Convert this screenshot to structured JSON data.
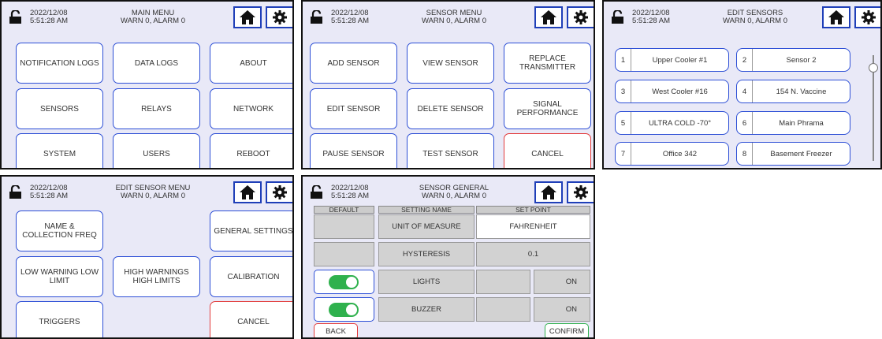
{
  "status": {
    "date": "2022/12/08",
    "time": "5:51:28 AM",
    "warn_alarm": "WARN 0, ALARM 0"
  },
  "colors": {
    "accent": "#2d4fd6",
    "cancel": "#e33b3b",
    "panel_bg": "#e9e9f7",
    "toggle_on": "#2fb14d"
  },
  "icons": {
    "lock": "unlock-icon",
    "home": "home-icon",
    "settings": "gear-icon"
  },
  "main_menu": {
    "title": "MAIN MENU",
    "buttons": [
      "NOTIFICATION LOGS",
      "DATA LOGS",
      "ABOUT",
      "SENSORS",
      "RELAYS",
      "NETWORK",
      "SYSTEM",
      "USERS",
      "REBOOT"
    ]
  },
  "sensor_menu": {
    "title": "SENSOR MENU",
    "buttons": [
      "ADD SENSOR",
      "VIEW SENSOR",
      "REPLACE TRANSMITTER",
      "EDIT SENSOR",
      "DELETE SENSOR",
      "SIGNAL PERFORMANCE",
      "PAUSE SENSOR",
      "TEST SENSOR",
      "CANCEL"
    ]
  },
  "edit_sensors": {
    "title": "EDIT SENSORS",
    "sensors": [
      {
        "num": "1",
        "name": "Upper Cooler #1"
      },
      {
        "num": "2",
        "name": "Sensor 2"
      },
      {
        "num": "3",
        "name": "West Cooler #16"
      },
      {
        "num": "4",
        "name": "154 N. Vaccine"
      },
      {
        "num": "5",
        "name": "ULTRA COLD -70°"
      },
      {
        "num": "6",
        "name": "Main Phrama"
      },
      {
        "num": "7",
        "name": "Office 342"
      },
      {
        "num": "8",
        "name": "Basement Freezer"
      }
    ]
  },
  "edit_sensor_menu": {
    "title": "EDIT SENSOR MENU",
    "buttons": [
      "NAME & COLLECTION FREQ",
      "GENERAL SETTINGS",
      "LOW WARNING LOW LIMIT",
      "HIGH WARNINGS HIGH LIMITS",
      "CALIBRATION",
      "TRIGGERS",
      "CANCEL"
    ]
  },
  "sensor_general": {
    "title": "SENSOR GENERAL",
    "headers": [
      "DEFAULT",
      "SETTING NAME",
      "SET POINT"
    ],
    "rows": [
      {
        "name": "UNIT OF MEASURE",
        "value": "FAHRENHEIT"
      },
      {
        "name": "HYSTERESIS",
        "value": "0.1"
      },
      {
        "name": "LIGHTS",
        "value": "ON",
        "toggle_on": true
      },
      {
        "name": "BUZZER",
        "value": "ON",
        "toggle_on": true
      }
    ],
    "back": "BACK",
    "confirm": "CONFIRM"
  }
}
